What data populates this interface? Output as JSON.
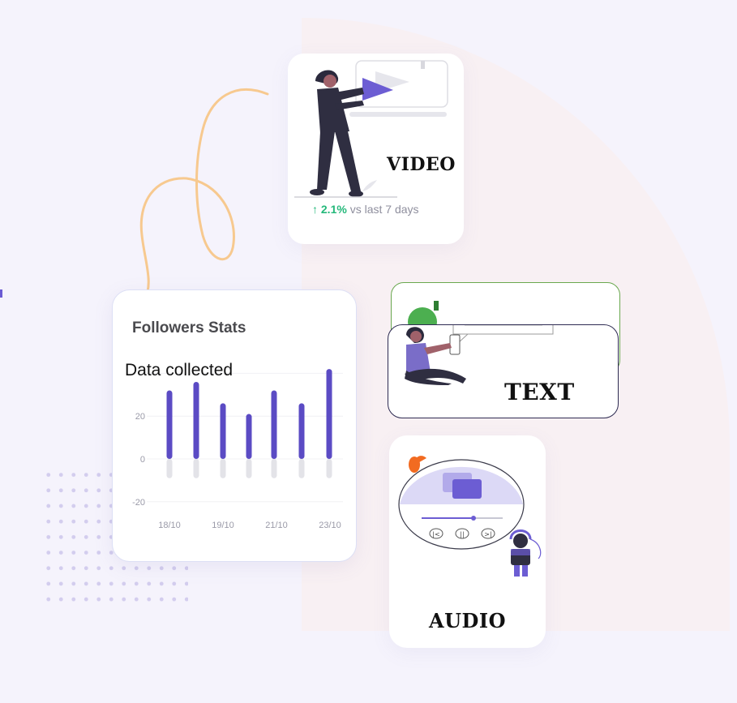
{
  "video_card": {
    "caption": "VIDEO",
    "stat_arrow": "↑",
    "stat_percent": "2.1%",
    "stat_text": "vs last 7 days"
  },
  "followers_card": {
    "title": "Followers Stats",
    "subtitle": "Data collected"
  },
  "text_card": {
    "caption": "TEXT"
  },
  "audio_card": {
    "caption": "AUDIO"
  },
  "colors": {
    "accent": "#5b4bc4",
    "illustration_purple": "#6c5dd3",
    "positive_green": "#24b87a",
    "squiggle": "#f7c98f"
  },
  "chart_data": {
    "type": "bar",
    "categories": [
      "18/10",
      "",
      "19/10",
      "",
      "21/10",
      "",
      "23/10"
    ],
    "x_tick_labels": [
      "18/10",
      "19/10",
      "21/10",
      "23/10"
    ],
    "y_tick_labels": [
      "20",
      "0",
      "-20"
    ],
    "series": [
      {
        "values": [
          32,
          36,
          26,
          21,
          32,
          26,
          42
        ]
      },
      {
        "values": [
          -9,
          -9,
          -9,
          -9,
          -9,
          -9,
          -9
        ]
      }
    ],
    "ylim": [
      -20,
      42
    ],
    "grid": true
  }
}
